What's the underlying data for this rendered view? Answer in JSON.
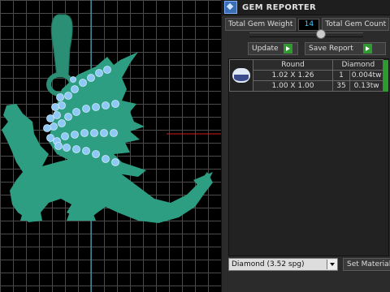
{
  "panel": {
    "title": "GEM REPORTER",
    "total_gem_weight_label": "Total Gem Weight",
    "total_gem_weight_value": "14",
    "total_gem_count_label": "Total Gem Count",
    "update_label": "Update",
    "save_report_label": "Save Report"
  },
  "table": {
    "headers": [
      "Round",
      "Diamond"
    ],
    "rows": [
      {
        "size": "1.02 X 1.26",
        "count": "1",
        "weight": "0.004tw"
      },
      {
        "size": "1.00 X 1.00",
        "count": "35",
        "weight": "0.13tw"
      }
    ]
  },
  "material": {
    "selected": "Diamond     (3.52 spg)",
    "set_material_label": "Set Material"
  },
  "colors": {
    "model": "#2e9e82",
    "gems": "#8fc8f5",
    "grid": "#4a4a4a",
    "axis_red": "#d02020",
    "axis_cyan": "#30c0e0"
  },
  "icons": {
    "app": "gem-reporter-app-icon",
    "gem_shape": "round-gem-icon",
    "go": "green-go-arrow-icon",
    "dropdown": "chevron-down-icon"
  }
}
